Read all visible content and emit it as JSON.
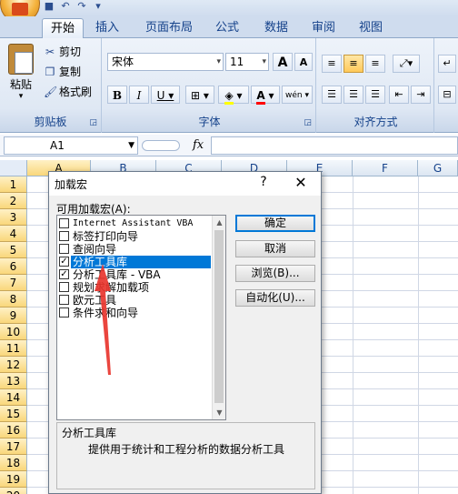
{
  "qat": {
    "icons": [
      "save-icon",
      "undo-icon",
      "redo-icon",
      "dropdown-icon"
    ]
  },
  "tabs": [
    "开始",
    "插入",
    "页面布局",
    "公式",
    "数据",
    "审阅",
    "视图"
  ],
  "ribbon": {
    "clipboard": {
      "paste": "粘贴",
      "cut": "剪切",
      "copy": "复制",
      "format_painter": "格式刷",
      "label": "剪贴板"
    },
    "font": {
      "font_name": "宋体",
      "font_size": "11",
      "grow": "A",
      "shrink": "A",
      "bold": "B",
      "italic": "I",
      "underline": "U",
      "font_color_letter": "A",
      "phonetic": "wén",
      "label": "字体"
    },
    "alignment": {
      "label": "对齐方式"
    }
  },
  "formula_bar": {
    "name_box": "A1",
    "fx": "fx",
    "formula": ""
  },
  "grid": {
    "columns": [
      "A",
      "B",
      "C",
      "D",
      "E",
      "F",
      "G"
    ],
    "rows": [
      "1",
      "2",
      "3",
      "4",
      "5",
      "6",
      "7",
      "8",
      "9",
      "10",
      "11",
      "12",
      "13",
      "14",
      "15",
      "16",
      "17",
      "18",
      "19",
      "20"
    ]
  },
  "dialog": {
    "title": "加载宏",
    "help": "?",
    "close": "✕",
    "list_label": "可用加载宏(A):",
    "items": [
      {
        "label": "Internet Assistant VBA",
        "checked": false,
        "selected": false
      },
      {
        "label": "标签打印向导",
        "checked": false,
        "selected": false
      },
      {
        "label": "查阅向导",
        "checked": false,
        "selected": false
      },
      {
        "label": "分析工具库",
        "checked": true,
        "selected": true
      },
      {
        "label": "分析工具库 - VBA",
        "checked": true,
        "selected": false
      },
      {
        "label": "规划求解加载项",
        "checked": false,
        "selected": false
      },
      {
        "label": "欧元工具",
        "checked": false,
        "selected": false
      },
      {
        "label": "条件求和向导",
        "checked": false,
        "selected": false
      }
    ],
    "buttons": {
      "ok": "确定",
      "cancel": "取消",
      "browse": "浏览(B)...",
      "automation": "自动化(U)..."
    },
    "description": {
      "title": "分析工具库",
      "body": "提供用于统计和工程分析的数据分析工具"
    }
  },
  "colors": {
    "accent": "#0078d7",
    "arrow": "#e8352e",
    "selected_header": "#f9d77b"
  }
}
